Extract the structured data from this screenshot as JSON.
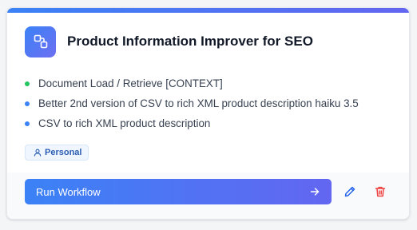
{
  "card": {
    "title": "Product Information Improver for SEO",
    "icon": "workflow-icon",
    "accent_gradient": [
      "#3b82f6",
      "#6366f1"
    ]
  },
  "steps": [
    {
      "label": "Document Load / Retrieve [CONTEXT]",
      "status_color": "#22c55e"
    },
    {
      "label": "Better 2nd version of CSV to rich XML product description haiku 3.5",
      "status_color": "#3b82f6"
    },
    {
      "label": "CSV to rich XML product description",
      "status_color": "#3b82f6"
    }
  ],
  "badge": {
    "label": "Personal",
    "icon": "user-icon"
  },
  "actions": {
    "run_label": "Run Workflow",
    "run_icon": "arrow-right-icon",
    "edit_icon": "pencil-icon",
    "delete_icon": "trash-icon",
    "edit_color": "#2563eb",
    "delete_color": "#ef4444"
  }
}
